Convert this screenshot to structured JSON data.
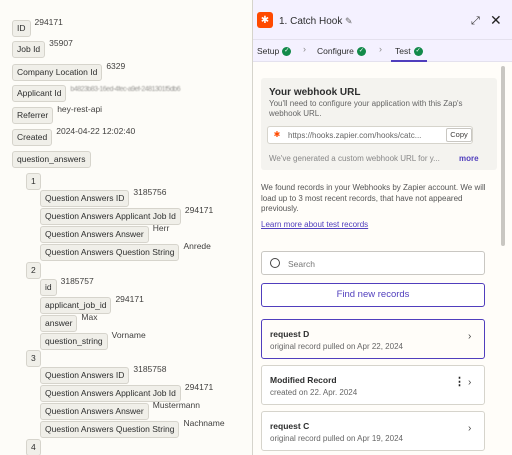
{
  "record": {
    "fields": [
      {
        "key": "ID",
        "value": "294171"
      },
      {
        "key": "Job Id",
        "value": "35907"
      },
      {
        "key": "Company Location Id",
        "value": "6329"
      },
      {
        "key": "Applicant Id",
        "value": "b4823b83-16ed-4fec-a9ef-2481301f5db6"
      },
      {
        "key": "Referrer",
        "value": "hey-rest-api"
      },
      {
        "key": "Created",
        "value": "2024-04-22 12:02:40"
      },
      {
        "key": "question_answers",
        "value": ""
      }
    ],
    "answers": [
      {
        "index": "1",
        "rows": [
          {
            "key": "Question Answers ID",
            "value": "3185756"
          },
          {
            "key": "Question Answers Applicant Job Id",
            "value": "294171"
          },
          {
            "key": "Question Answers Answer",
            "value": "Herr"
          },
          {
            "key": "Question Answers Question String",
            "value": "Anrede"
          }
        ]
      },
      {
        "index": "2",
        "rows": [
          {
            "key": "id",
            "value": "3185757"
          },
          {
            "key": "applicant_job_id",
            "value": "294171"
          },
          {
            "key": "answer",
            "value": "Max"
          },
          {
            "key": "question_string",
            "value": "Vorname"
          }
        ]
      },
      {
        "index": "3",
        "rows": [
          {
            "key": "Question Answers ID",
            "value": "3185758"
          },
          {
            "key": "Question Answers Applicant Job Id",
            "value": "294171"
          },
          {
            "key": "Question Answers Answer",
            "value": "Mustermann"
          },
          {
            "key": "Question Answers Question String",
            "value": "Nachname"
          }
        ]
      },
      {
        "index": "4",
        "rows": []
      }
    ]
  },
  "panel": {
    "title": "1. Catch Hook",
    "tabs": [
      {
        "label": "Setup",
        "done": true
      },
      {
        "label": "Configure",
        "done": true
      },
      {
        "label": "Test",
        "done": true
      }
    ],
    "webhook": {
      "title": "Your webhook URL",
      "desc": "You'll need to configure your application with this Zap's webhook URL.",
      "url": "https://hooks.zapier.com/hooks/catc...",
      "copy_label": "Copy",
      "note": "We've generated a custom webhook URL for y...",
      "more_label": "more"
    },
    "found_text": "We found records in your Webhooks by Zapier account. We will load up to 3 most recent records, that have not appeared previously.",
    "learn_link": "Learn more about test records",
    "search_placeholder": "Search",
    "find_button": "Find new records",
    "records": [
      {
        "title": "request D",
        "sub": "original record pulled on Apr 22, 2024",
        "selected": true
      },
      {
        "title": "Modified Record",
        "sub": "created on 22. Apr. 2024",
        "selected": false
      },
      {
        "title": "request C",
        "sub": "original record pulled on Apr 19, 2024",
        "selected": false
      }
    ]
  },
  "colors": {
    "accent": "#503ebd",
    "brand": "#ff4a00",
    "success": "#138a4a"
  },
  "icons": [
    "zapier-logo-icon",
    "pencil-icon",
    "expand-icon",
    "close-icon",
    "check-circle-icon",
    "chevron-right-icon",
    "search-icon",
    "more-vertical-icon"
  ]
}
